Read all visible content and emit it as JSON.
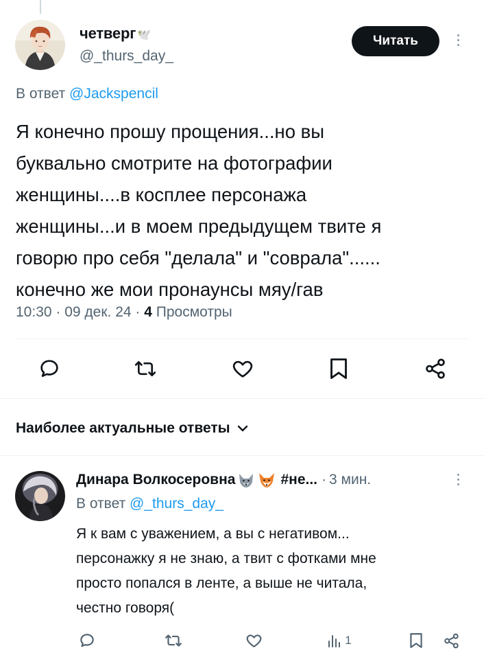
{
  "tweet": {
    "author_name": "четверг",
    "author_flag": "🕊️",
    "author_handle": "@_thurs_day_",
    "follow_label": "Читать",
    "reply_prefix": "В ответ",
    "reply_to": "@Jackspencil",
    "text_lines": [
      "Я конечно прошу прощения...но вы",
      "буквально смотрите на фотографии",
      "женщины....в косплее персонажа",
      "женщины...и в моем предыдущем твите я",
      "говорю про себя \"делала\" и \"соврала\"......",
      "конечно же мои пронаунсы мяу/гав"
    ],
    "time": "10:30",
    "date": "09 дек. 24",
    "views_count": "4",
    "views_label": "Просмотры",
    "actions": [
      "reply-icon",
      "retweet-icon",
      "like-icon",
      "bookmark-icon",
      "share-icon"
    ]
  },
  "replies_section": {
    "title": "Наиболее актуальные ответы"
  },
  "reply": {
    "author_name": "Динара Волкосеровна",
    "author_name_tail": "#не...",
    "separator": "·",
    "time": "3 мин.",
    "reply_prefix": "В ответ",
    "reply_to": "@_thurs_day_",
    "text_lines": [
      "Я к вам с уважением, а вы с негативом...",
      "персонажку я не знаю, а твит с фотками мне",
      "просто попался в ленте, а выше не читала,",
      "честно говоря("
    ],
    "views_count": "1",
    "actions": [
      "reply-icon",
      "retweet-icon",
      "like-icon",
      "views-icon",
      "bookmark-icon",
      "share-icon"
    ]
  },
  "colors": {
    "text": "#0f1419",
    "secondary": "#536471",
    "link": "#1d9bf0",
    "button_bg": "#0f1419",
    "divider": "#eff3f4"
  }
}
